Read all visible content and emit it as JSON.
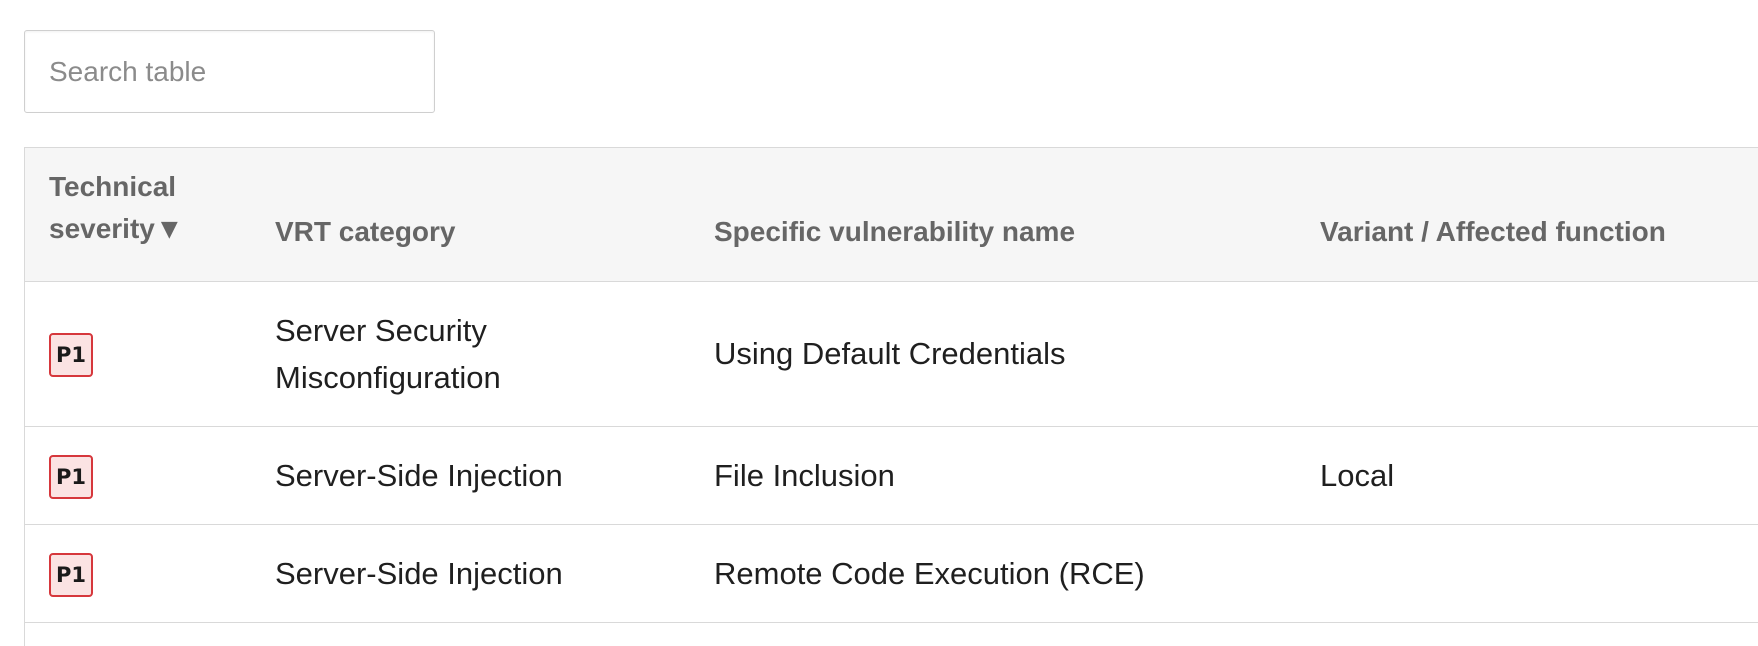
{
  "search": {
    "placeholder": "Search table",
    "value": ""
  },
  "table": {
    "headers": {
      "severity_line1": "Technical",
      "severity_line2": "severity",
      "severity_sort_glyph": "▼",
      "vrt_category": "VRT category",
      "vulnerability_name": "Specific vulnerability name",
      "variant": "Variant / Affected function"
    },
    "rows": [
      {
        "severity": "P1",
        "vrt_category": "Server Security Misconfiguration",
        "vulnerability_name": "Using Default Credentials",
        "variant": ""
      },
      {
        "severity": "P1",
        "vrt_category": "Server-Side Injection",
        "vulnerability_name": "File Inclusion",
        "variant": "Local"
      },
      {
        "severity": "P1",
        "vrt_category": "Server-Side Injection",
        "vulnerability_name": "Remote Code Execution (RCE)",
        "variant": ""
      }
    ]
  },
  "colors": {
    "badge_border": "#d6373c",
    "badge_fill": "#fbe3e3",
    "header_bg": "#f6f6f6",
    "header_text": "#666666"
  }
}
